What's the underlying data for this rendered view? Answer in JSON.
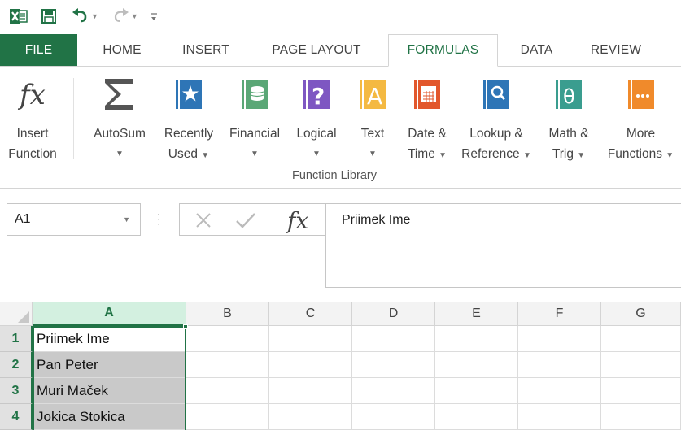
{
  "quick_access": {
    "icons": [
      "excel-logo-icon",
      "save-icon",
      "undo-icon",
      "redo-icon",
      "customize-icon"
    ]
  },
  "tabs": [
    {
      "label": "FILE",
      "active": false
    },
    {
      "label": "HOME",
      "active": false
    },
    {
      "label": "INSERT",
      "active": false
    },
    {
      "label": "PAGE LAYOUT",
      "active": false
    },
    {
      "label": "FORMULAS",
      "active": true
    },
    {
      "label": "DATA",
      "active": false
    },
    {
      "label": "REVIEW",
      "active": false
    }
  ],
  "ribbon": {
    "insert_function": {
      "line1": "Insert",
      "line2": "Function"
    },
    "autosum": {
      "line1": "AutoSum"
    },
    "recently_used": {
      "line1": "Recently",
      "line2": "Used"
    },
    "financial": {
      "line1": "Financial"
    },
    "logical": {
      "line1": "Logical"
    },
    "text": {
      "line1": "Text"
    },
    "date_time": {
      "line1": "Date &",
      "line2": "Time"
    },
    "lookup_reference": {
      "line1": "Lookup &",
      "line2": "Reference"
    },
    "math_trig": {
      "line1": "Math &",
      "line2": "Trig"
    },
    "more_functions": {
      "line1": "More",
      "line2": "Functions"
    },
    "group_label": "Function Library"
  },
  "formula_bar": {
    "name_box": "A1",
    "formula": "Priimek  Ime"
  },
  "grid": {
    "columns": [
      "A",
      "B",
      "C",
      "D",
      "E",
      "F",
      "G"
    ],
    "rows": [
      "1",
      "2",
      "3",
      "4"
    ],
    "cells_a": [
      "Priimek  Ime",
      "Pan Peter",
      "Muri Maček",
      "Jokica Stokica"
    ]
  },
  "colors": {
    "accent": "#217346",
    "selection_fill": "#c9c9c9"
  }
}
